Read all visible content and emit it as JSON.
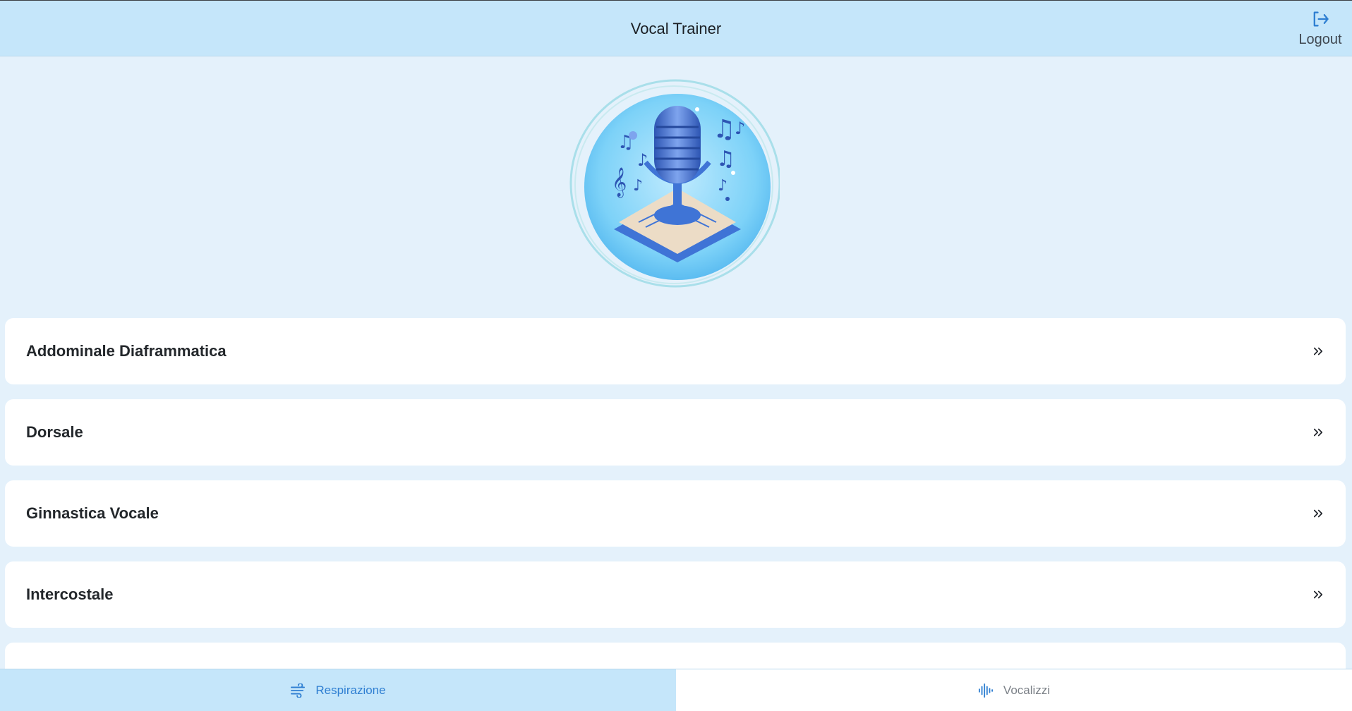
{
  "header": {
    "title": "Vocal Trainer",
    "logout_label": "Logout",
    "logout_icon": "logout-icon"
  },
  "logo": {
    "icon": "microphone-music-logo",
    "colors": {
      "circle": "#7dd2f8",
      "mic": "#3f74d6",
      "base": "#e6d4bd"
    }
  },
  "exercises": [
    {
      "label": "Addominale Diaframmatica"
    },
    {
      "label": "Dorsale"
    },
    {
      "label": "Ginnastica Vocale"
    },
    {
      "label": "Intercostale"
    },
    {
      "label": ""
    }
  ],
  "tabs": [
    {
      "label": "Respirazione",
      "icon": "breath-wind-icon",
      "active": true
    },
    {
      "label": "Vocalizzi",
      "icon": "audio-wave-icon",
      "active": false
    }
  ],
  "colors": {
    "header_bg": "#c5e6fa",
    "page_bg": "#e4f1fb",
    "accent": "#2f7fd2",
    "card_bg": "#ffffff"
  }
}
